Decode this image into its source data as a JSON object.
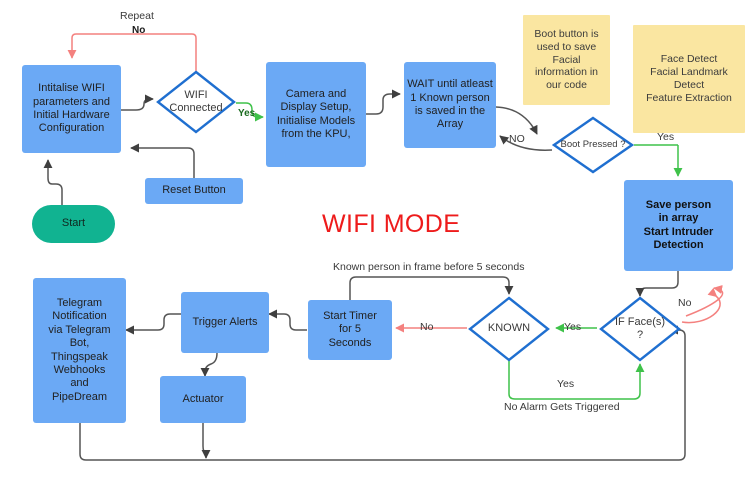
{
  "diagram": {
    "title": "WIFI MODE",
    "title_color": "#ee1b1b",
    "colors": {
      "process_fill": "#6ba9f5",
      "start_fill": "#11b391",
      "note_fill": "#fae6a1",
      "decision_stroke": "#1f6fd0",
      "edge_default": "#555555",
      "edge_yes": "#3fc24a",
      "edge_no": "#f4817f"
    },
    "nodes": {
      "init_wifi": "Intitalise WIFI parameters and Initial Hardware Configuration",
      "wifi_connected": "WIFI Connected",
      "camera_setup": "Camera and Display Setup, Initialise Models from the KPU,",
      "wait_known": "WAIT until atleast 1 Known person is saved in the Array",
      "boot_pressed": "Boot Pressed ?",
      "save_person": "Save person in array Start Intruder Detection",
      "reset_button": "Reset Button",
      "start": "Start",
      "note_boot": "Boot button is used to save Facial information in our code",
      "note_face": "Face Detect Facial Landmark Detect Feature Extraction",
      "if_faces": "IF Face(s) ?",
      "known": "KNOWN",
      "start_timer": "Start Timer for 5 Seconds",
      "trigger_alerts": "Trigger Alerts",
      "actuator": "Actuator",
      "telegram": "Telegram Notification via Telegram Bot, Thingspeak Webhooks and PipeDream"
    },
    "node_lines": {
      "init_wifi": [
        "Intitalise WIFI",
        "parameters and",
        "Initial Hardware",
        "Configuration"
      ],
      "wifi_connected": [
        "WIFI",
        "Connected"
      ],
      "camera_setup": [
        "Camera and",
        "Display Setup,",
        "Initialise Models",
        "from the KPU,"
      ],
      "wait_known": [
        "WAIT until atleast",
        "1 Known person",
        "is saved in the",
        "Array"
      ],
      "boot_pressed": [
        "Boot Pressed ?"
      ],
      "save_person": [
        "Save person",
        "in array",
        "Start Intruder",
        "Detection"
      ],
      "reset_button": [
        "Reset Button"
      ],
      "start": [
        "Start"
      ],
      "note_boot": [
        "Boot button is",
        "used to save",
        "Facial",
        "information in",
        "our code"
      ],
      "note_face": [
        "Face Detect",
        "Facial Landmark",
        "Detect",
        "Feature Extraction"
      ],
      "if_faces": [
        "IF Face(s)",
        "?"
      ],
      "known": [
        "KNOWN"
      ],
      "start_timer": [
        "Start Timer",
        "for 5",
        "Seconds"
      ],
      "trigger_alerts": [
        "Trigger Alerts"
      ],
      "actuator": [
        "Actuator"
      ],
      "telegram": [
        "Telegram",
        "Notification",
        "via Telegram",
        "Bot,",
        "Thingspeak",
        "Webhooks",
        "and",
        "PipeDream"
      ]
    },
    "edge_labels": {
      "repeat": "Repeat",
      "repeat_no": "No",
      "wifi_yes": "Yes",
      "boot_no": "NO",
      "boot_yes": "Yes",
      "faces_no": "No",
      "faces_yes_known": "Yes",
      "known_no": "No",
      "known_yes": "Yes",
      "known_in_frame": "Known person in frame before 5 seconds",
      "no_alarm": "No Alarm Gets Triggered"
    }
  }
}
